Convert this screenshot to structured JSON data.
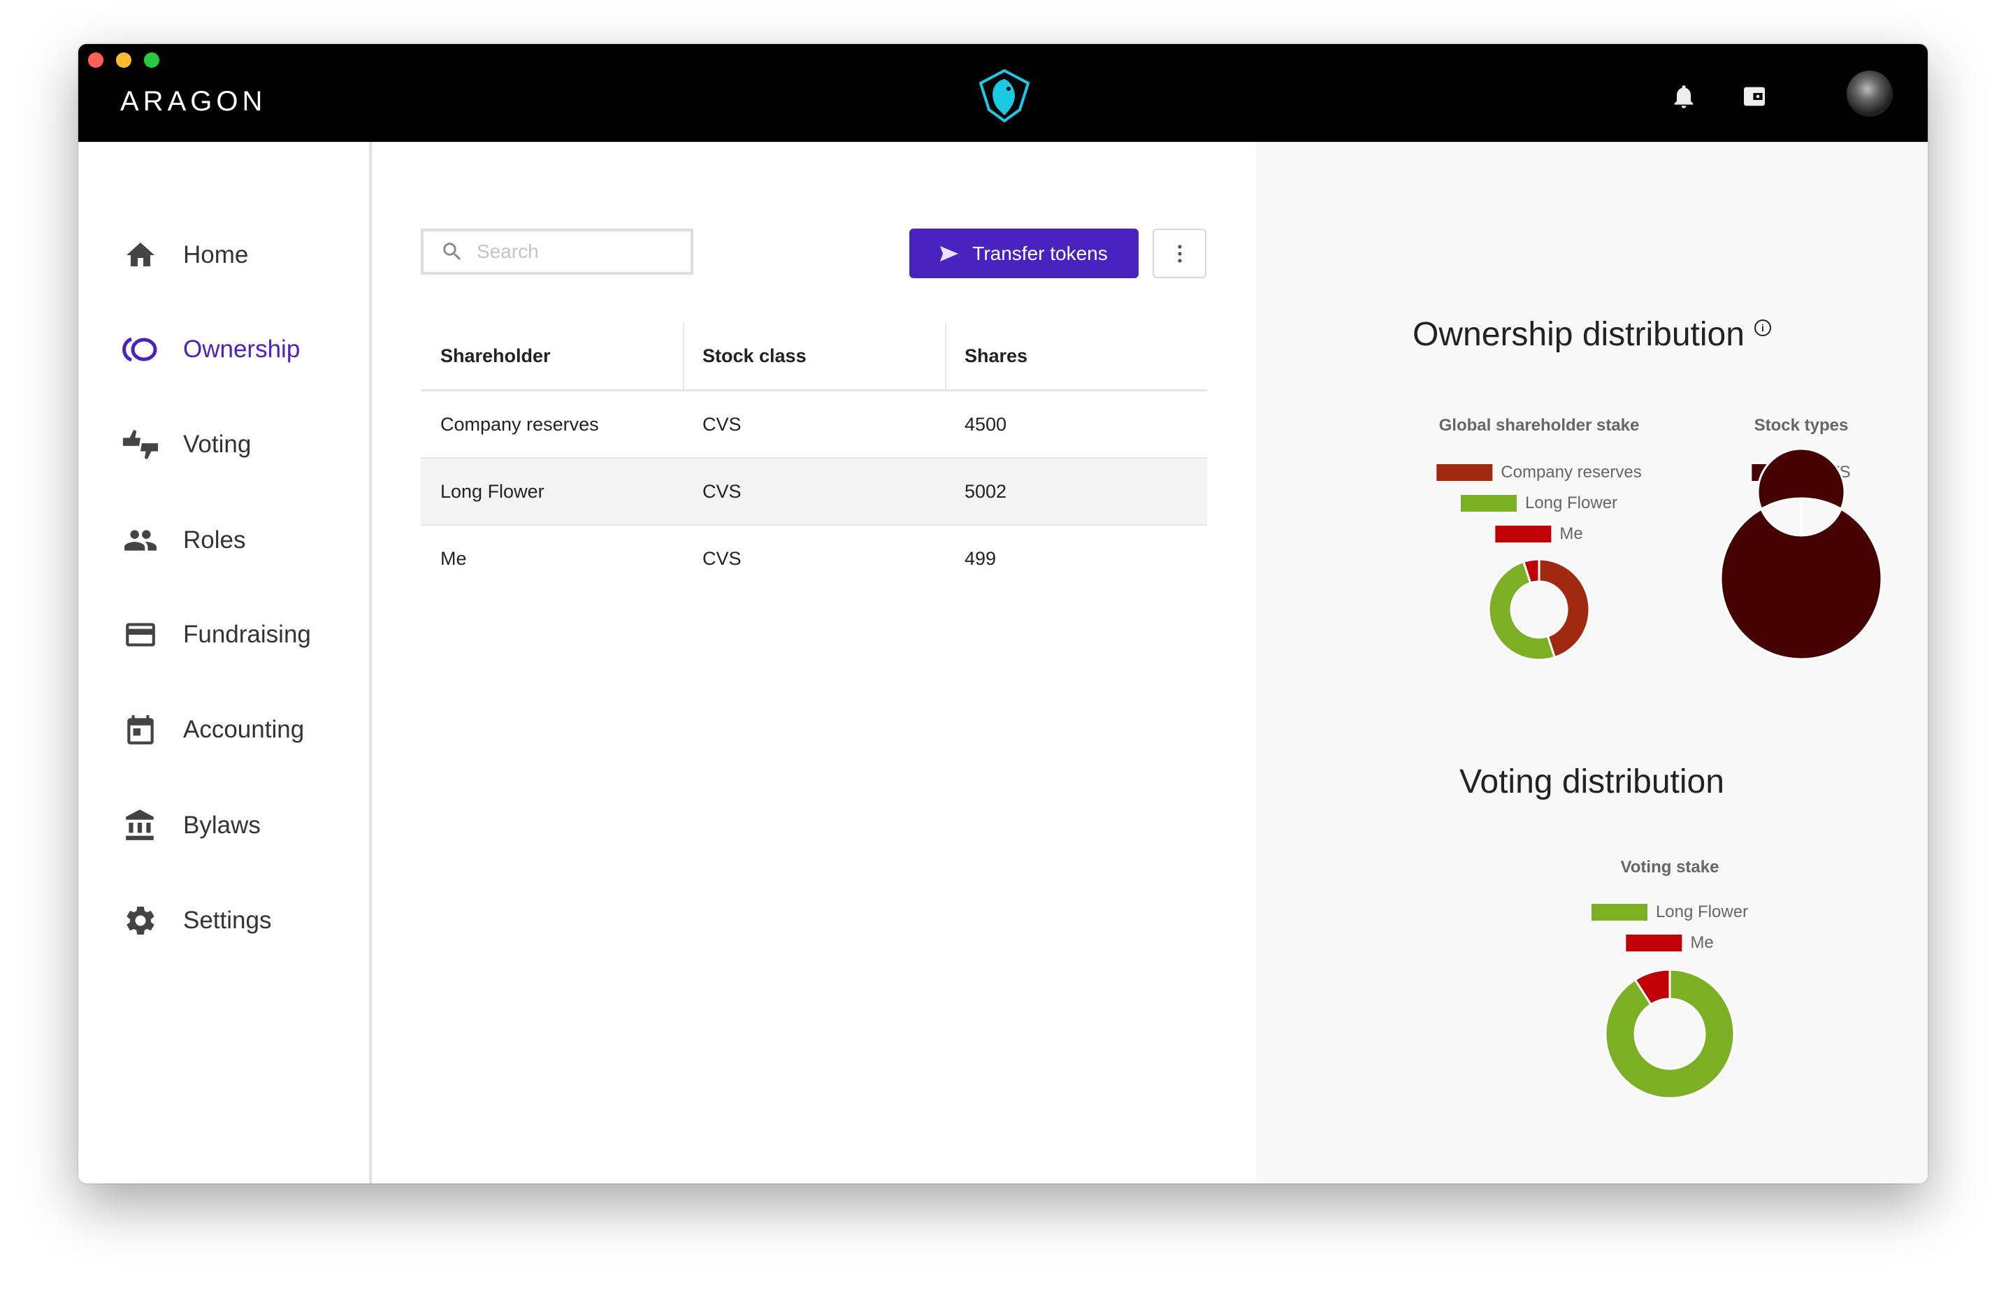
{
  "app": {
    "brand": "ARAGON",
    "header_icons": [
      "notification-bell-icon",
      "wallet-icon"
    ],
    "traffic_lights": [
      "#ff5f57",
      "#febc2e",
      "#28c840"
    ]
  },
  "sidebar": {
    "active_color": "#4a22c0",
    "items": [
      {
        "label": "Home",
        "icon": "home-icon"
      },
      {
        "label": "Ownership",
        "icon": "ownership-icon",
        "active": true
      },
      {
        "label": "Voting",
        "icon": "voting-icon"
      },
      {
        "label": "Roles",
        "icon": "roles-icon"
      },
      {
        "label": "Fundraising",
        "icon": "credit-card-icon"
      },
      {
        "label": "Accounting",
        "icon": "calendar-icon"
      },
      {
        "label": "Bylaws",
        "icon": "bank-icon"
      },
      {
        "label": "Settings",
        "icon": "gear-icon"
      }
    ]
  },
  "toolbar": {
    "search_placeholder": "Search",
    "search_value": "",
    "transfer_label": "Transfer tokens",
    "primary_color": "#4a22c0"
  },
  "table": {
    "columns": [
      "Shareholder",
      "Stock class",
      "Shares"
    ],
    "rows": [
      [
        "Company reserves",
        "CVS",
        "4500"
      ],
      [
        "Long Flower",
        "CVS",
        "5002"
      ],
      [
        "Me",
        "CVS",
        "499"
      ]
    ]
  },
  "panel": {
    "ownership_title": "Ownership distribution",
    "voting_title": "Voting distribution"
  },
  "chart_data": [
    {
      "type": "pie",
      "title": "Global shareholder stake",
      "categories": [
        "Company reserves",
        "Long Flower",
        "Me"
      ],
      "values": [
        4500,
        5002,
        499
      ],
      "colors": [
        "#a0290f",
        "#7daf25",
        "#c00006"
      ],
      "legend": "top"
    },
    {
      "type": "pie",
      "title": "Stock types",
      "categories": [
        "CVS"
      ],
      "values": [
        10001
      ],
      "colors": [
        "#450200"
      ],
      "legend": "top"
    },
    {
      "type": "pie",
      "title": "Voting stake",
      "categories": [
        "Long Flower",
        "Me"
      ],
      "values": [
        5002,
        499
      ],
      "colors": [
        "#7daf25",
        "#c00006"
      ],
      "legend": "top"
    }
  ]
}
